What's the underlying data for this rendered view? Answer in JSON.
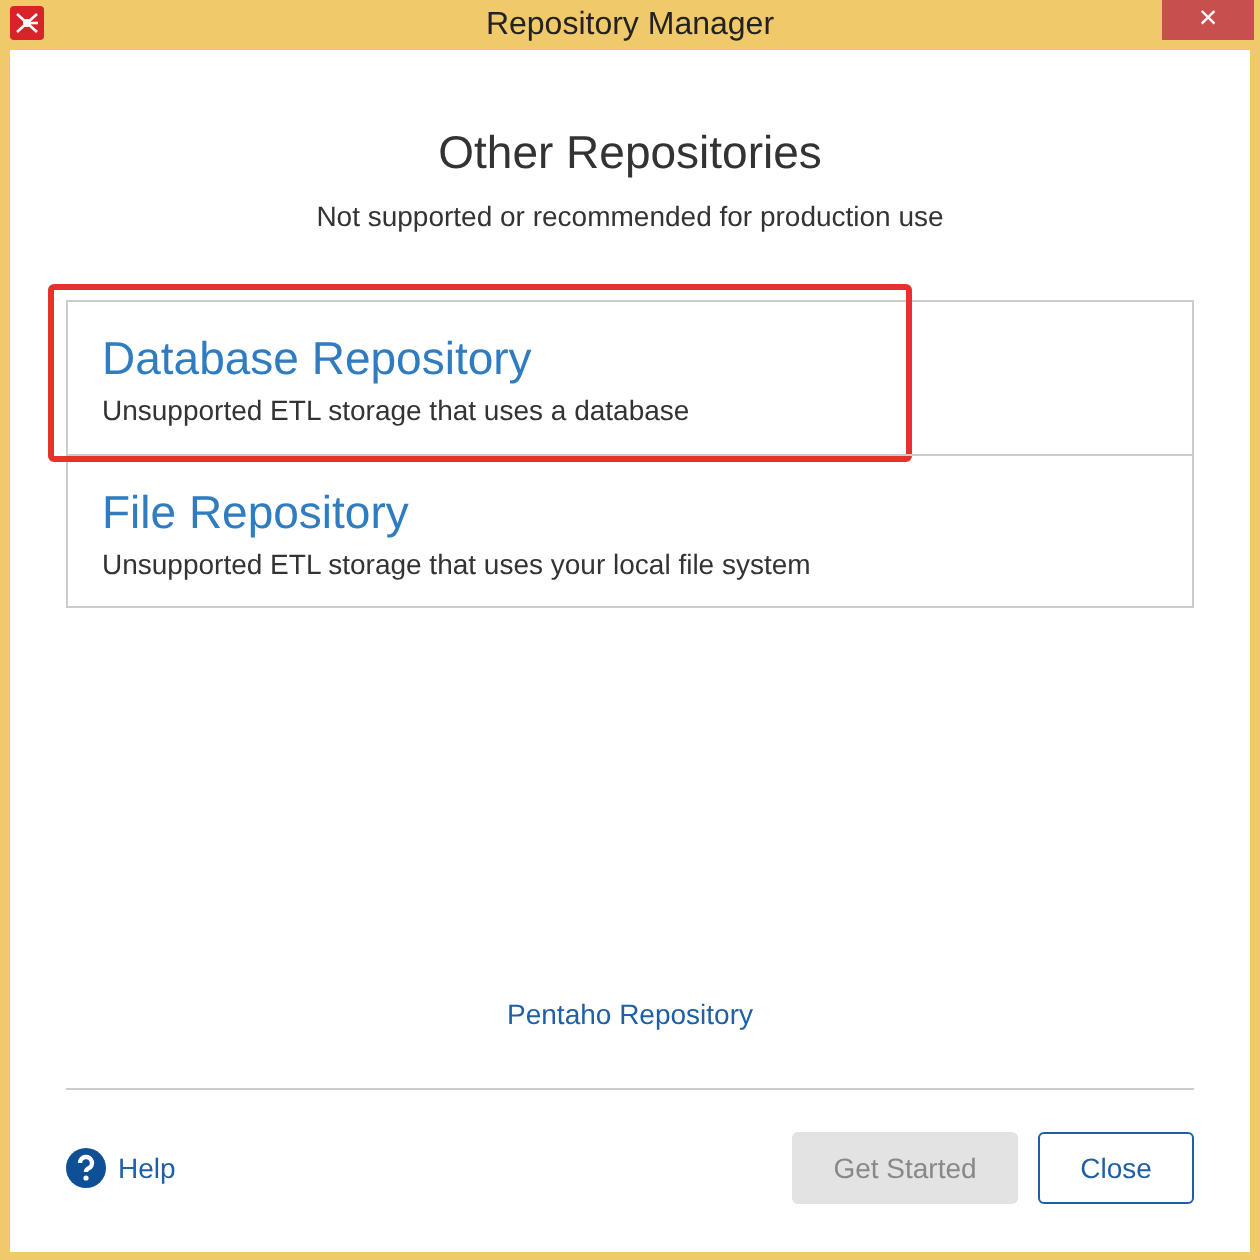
{
  "window": {
    "title": "Repository Manager",
    "close": "×"
  },
  "heading": "Other Repositories",
  "subheading": "Not supported or recommended for production use",
  "repositories": [
    {
      "name": "Database Repository",
      "description": "Unsupported ETL storage that uses a database",
      "highlighted": true
    },
    {
      "name": "File Repository",
      "description": "Unsupported ETL storage that uses your local file system",
      "highlighted": false
    }
  ],
  "link": "Pentaho Repository",
  "help": "Help",
  "buttons": [
    {
      "label": "Get Started",
      "disabled": true
    },
    {
      "label": "Close",
      "disabled": false
    }
  ]
}
